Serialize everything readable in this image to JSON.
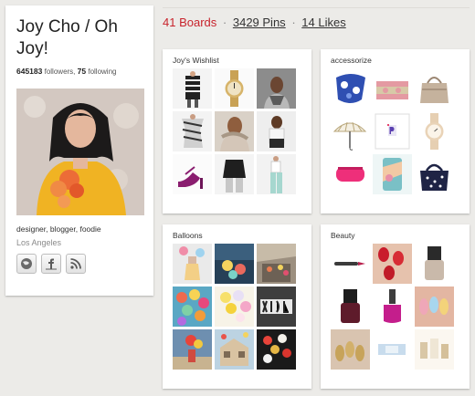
{
  "profile": {
    "name": "Joy Cho / Oh Joy!",
    "followers_count": "645183",
    "followers_label": "followers,",
    "following_count": "75",
    "following_label": "following",
    "bio": "designer, blogger, foodie",
    "location": "Los Angeles",
    "social_icons": [
      "website-icon",
      "facebook-icon",
      "rss-icon"
    ]
  },
  "stats_bar": {
    "boards": "41 Boards",
    "pins": "3429 Pins",
    "likes": "14 Likes",
    "separator": "·"
  },
  "boards": [
    {
      "title": "Joy's Wishlist"
    },
    {
      "title": "accessorize"
    },
    {
      "title": "Balloons"
    },
    {
      "title": "Beauty"
    }
  ],
  "colors": {
    "accent": "#c8232c",
    "background": "#ecebe8",
    "card": "#ffffff"
  }
}
